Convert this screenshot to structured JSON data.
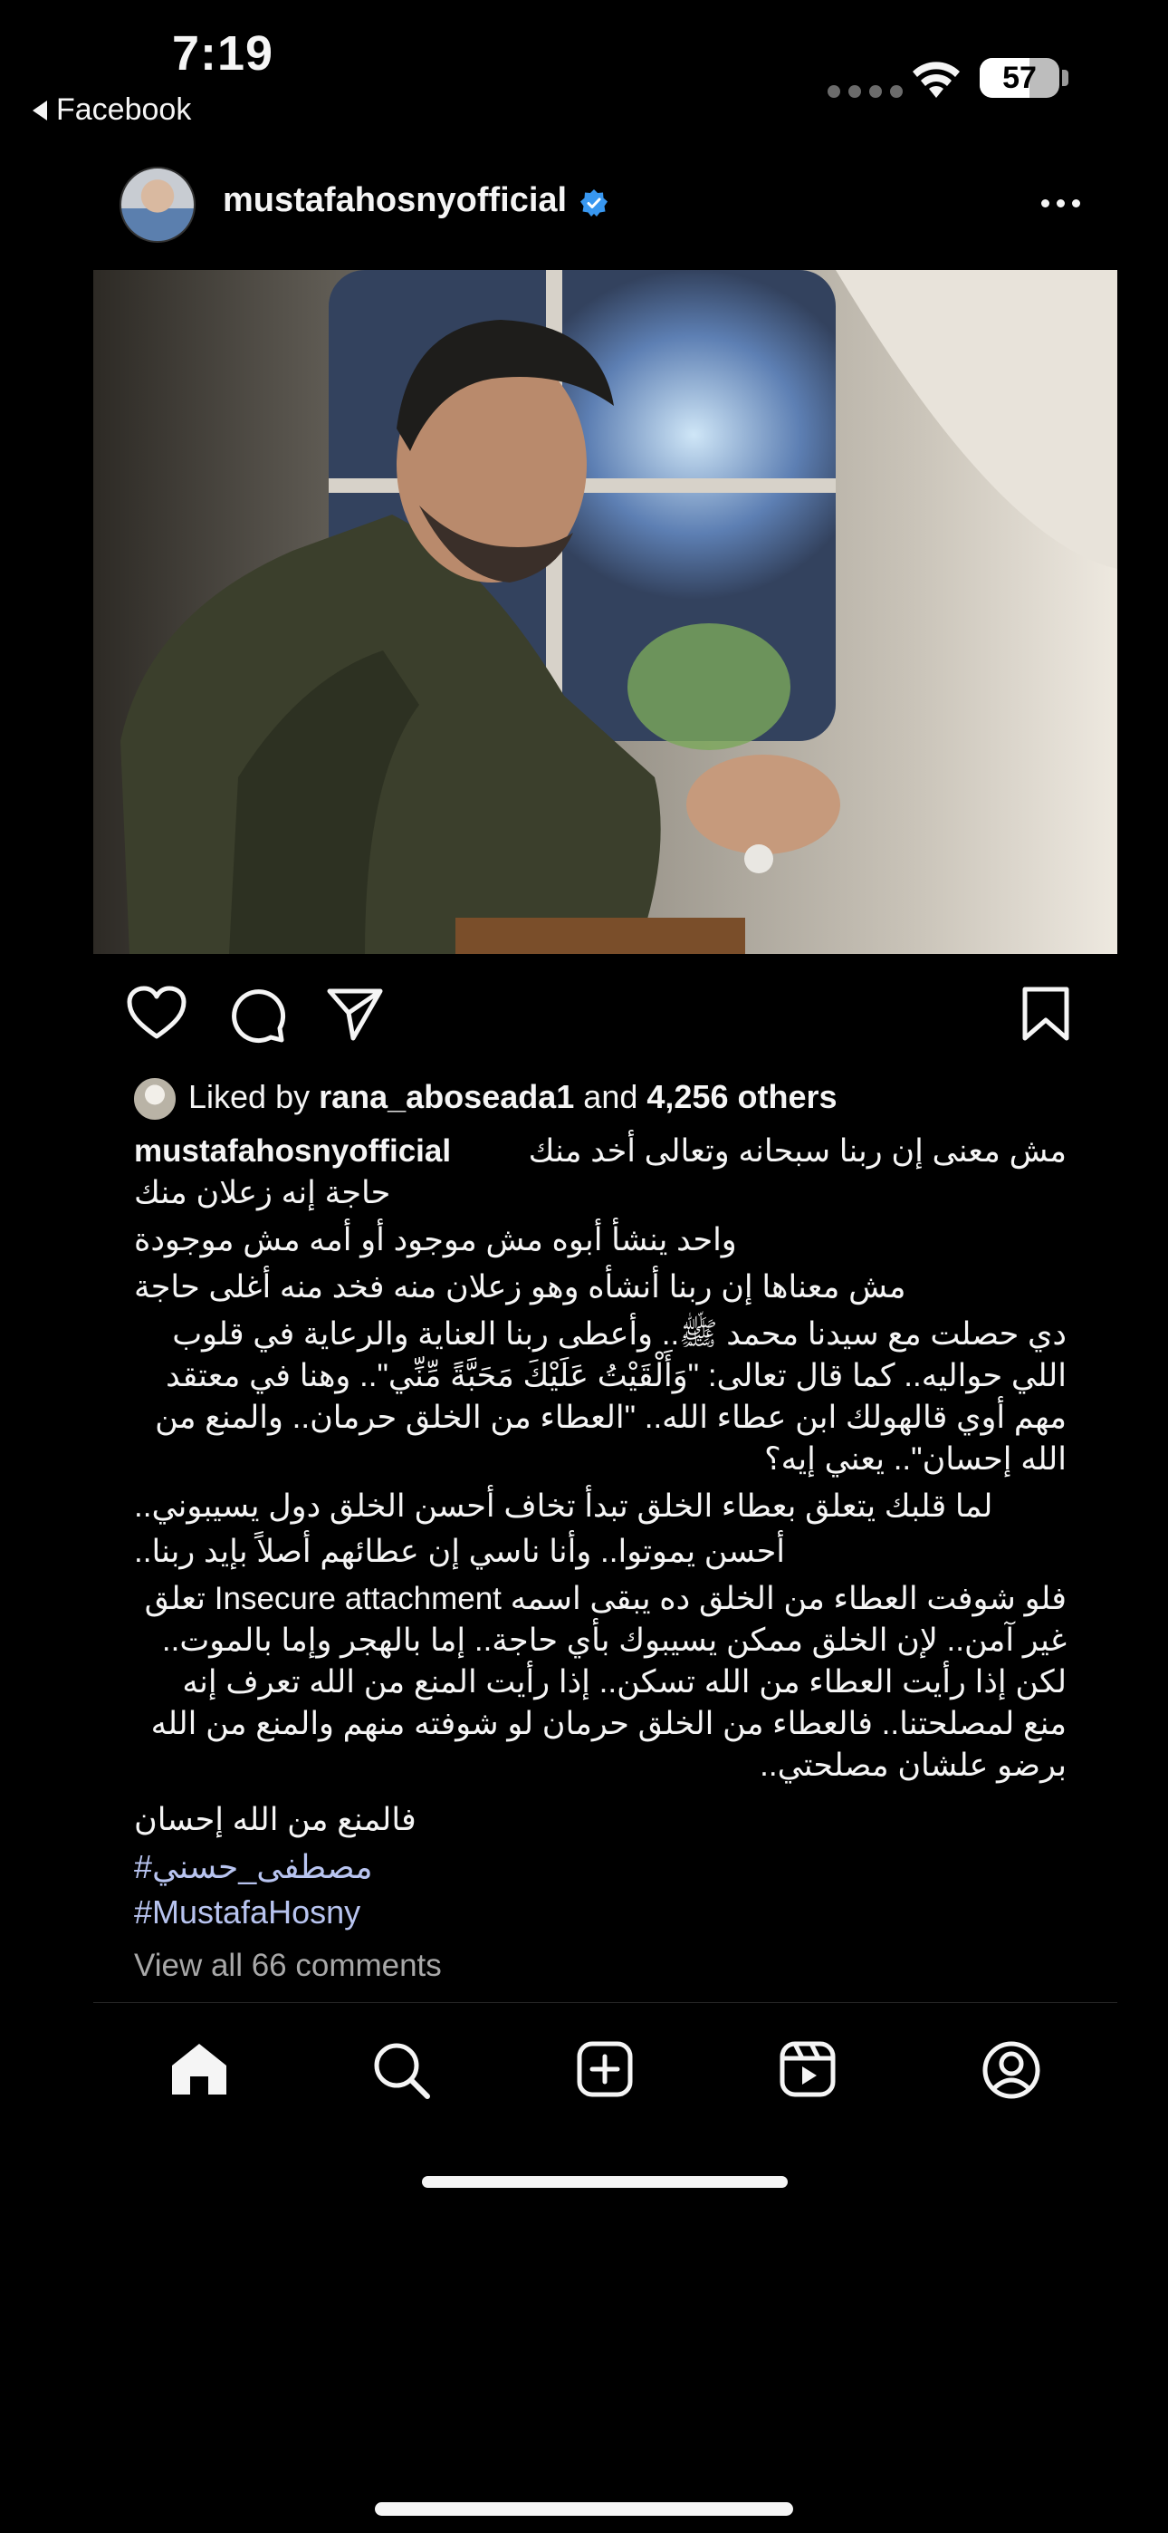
{
  "status_bar": {
    "time": "7:19",
    "back_label": "Facebook",
    "battery": "57"
  },
  "post": {
    "username": "mustafahosnyofficial",
    "verified": true,
    "likes": {
      "prefix": "Liked by",
      "liker": "rana_aboseada1",
      "connector": "and",
      "count_text": "4,256 others"
    },
    "caption": {
      "line1": "مش معنى إن ربنا سبحانه وتعالى أخد منك",
      "line2": "حاجة إنه زعلان منك",
      "line3": "واحد ينشأ أبوه مش موجود أو أمه مش موجودة",
      "line4": "مش معناها إن ربنا أنشأه وهو زعلان منه فخد منه أغلى حاجة",
      "para2": "دي حصلت مع سيدنا محمد ﷺ.. وأعطى ربنا العناية والرعاية في قلوب اللي حواليه.. كما قال تعالى: \"وَأَلْقَيْتُ عَلَيْكَ مَحَبَّةً مِّنِّي\".. وهنا في معتقد مهم أوي قالهولك ابن عطاء الله.. \"العطاء من الخلق حرمان.. والمنع من الله إحسان\".. يعني إيه؟",
      "para3a": "لما قلبك يتعلق بعطاء الخلق تبدأ تخاف أحسن الخلق دول يسيبوني..",
      "para3b": "أحسن يموتوا.. وأنا ناسي إن عطائهم أصلاً بإيد ربنا..",
      "para4": "فلو شوفت العطاء من الخلق ده يبقى اسمه Insecure attachment تعلق غير آمن.. لإن الخلق ممكن يسيبوك بأي حاجة.. إما بالهجر وإما بالموت.. لكن إذا رأيت العطاء من الله تسكن.. إذا رأيت المنع من الله تعرف إنه منع لمصلحتنا.. فالعطاء من الخلق حرمان لو شوفته منهم والمنع من الله برضو علشان مصلحتي..",
      "para5": "فالمنع من الله إحسان"
    },
    "hashtags": [
      "#مصطفى_حسني",
      "#MustafaHosny"
    ],
    "view_comments": "View all 66 comments"
  },
  "nav": {
    "items": [
      "home-icon",
      "search-icon",
      "create-icon",
      "reels-icon",
      "profile-icon"
    ]
  },
  "colors": {
    "background": "#000000",
    "text": "#f5f5f5",
    "hashtag": "#b8c4f0",
    "muted": "#a8a8a8",
    "verified": "#3897f0"
  }
}
